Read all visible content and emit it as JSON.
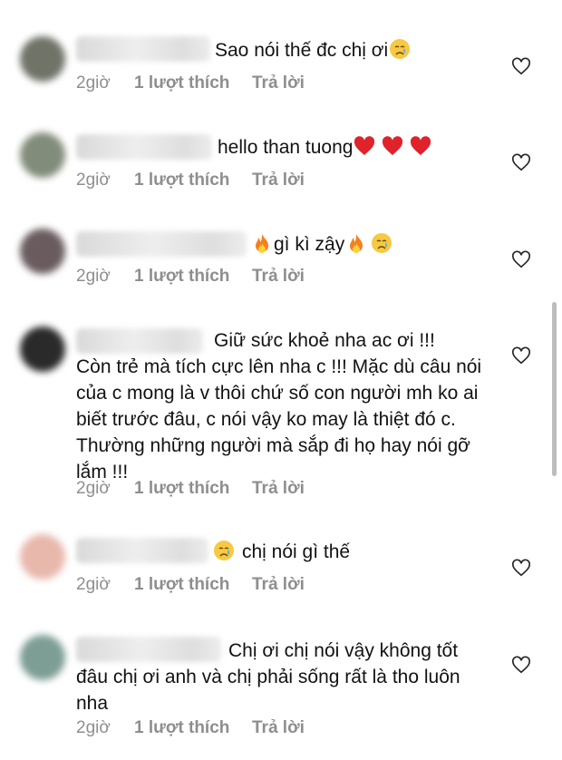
{
  "comments": [
    {
      "text": "Sao nói thế đc chị ơi",
      "emoji_after": [
        "crying-face"
      ],
      "time": "2giờ",
      "likes": "1 lượt thích",
      "reply": "Trả lời",
      "avatar_color": "#6f7368"
    },
    {
      "text": "hello than tuong",
      "emoji_after": [
        "red-heart",
        "red-heart",
        "red-heart"
      ],
      "time": "2giờ",
      "likes": "1 lượt thích",
      "reply": "Trả lời",
      "avatar_color": "#828c7a"
    },
    {
      "text": "gì kì zậy",
      "emoji_before": [
        "fire"
      ],
      "emoji_after": [
        "fire",
        "crying-face"
      ],
      "time": "2giờ",
      "likes": "1 lượt thích",
      "reply": "Trả lời",
      "avatar_color": "#6a5c5e"
    },
    {
      "text": "Giữ sức khoẻ nha ac ơi !!!\nCòn trẻ mà tích cực lên nha c !!! Mặc dù câu nói của c mong là v thôi chứ số con người mh ko ai biết trước đâu, c nói vậy ko may là thiệt đó c. Thường những người mà sắp đi họ hay nói gỡ lắm !!!",
      "time": "2giờ",
      "likes": "1 lượt thích",
      "reply": "Trả lời",
      "avatar_color": "#2a2a2a"
    },
    {
      "text": "chị nói gì thế",
      "emoji_before": [
        "crying-face"
      ],
      "time": "2giờ",
      "likes": "1 lượt thích",
      "reply": "Trả lời",
      "avatar_color": "#e8b8ac"
    },
    {
      "text": "Chị ơi chị nói vậy không tốt đâu chị ơi anh và chị phải sống rất là tho luôn nha",
      "time": "2giờ",
      "likes": "1 lượt thích",
      "reply": "Trả lời",
      "avatar_color": "#7d9e95"
    }
  ],
  "icons": {
    "like": "heart-outline-icon"
  }
}
